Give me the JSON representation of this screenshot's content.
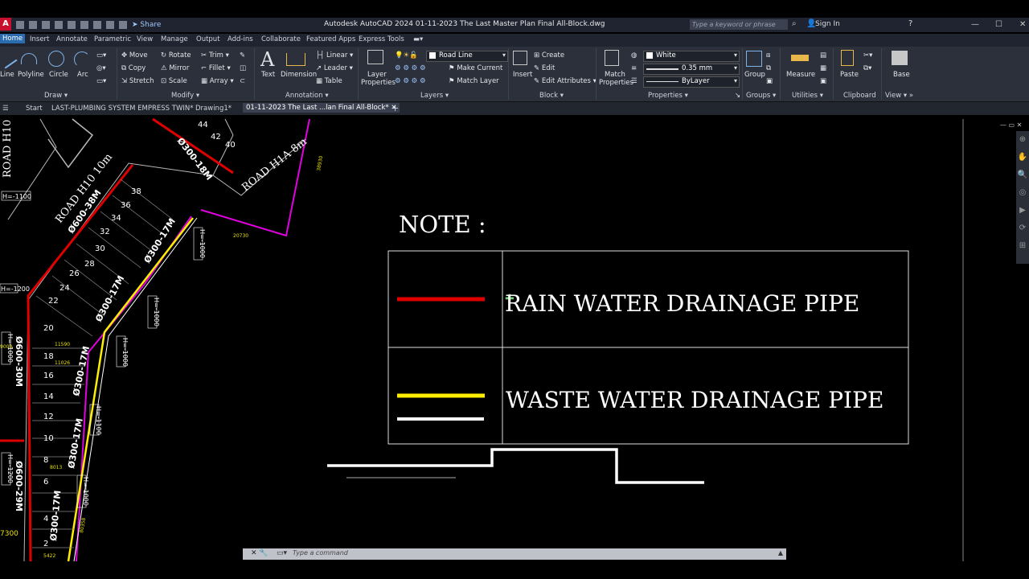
{
  "app": {
    "logo": "A",
    "title": "Autodesk AutoCAD 2024    01-11-2023 The Last Master Plan Final All-Block.dwg",
    "share": "Share",
    "search_placeholder": "Type a keyword or phrase",
    "sign_in": "Sign In"
  },
  "menu_tabs": [
    "Home",
    "Insert",
    "Annotate",
    "Parametric",
    "View",
    "Manage",
    "Output",
    "Add-ins",
    "Collaborate",
    "Featured Apps",
    "Express Tools"
  ],
  "ribbon": {
    "draw": {
      "line": "Line",
      "polyline": "Polyline",
      "circle": "Circle",
      "arc": "Arc",
      "panel": "Draw"
    },
    "modify": {
      "move": "Move",
      "rotate": "Rotate",
      "trim": "Trim",
      "copy": "Copy",
      "mirror": "Mirror",
      "fillet": "Fillet",
      "stretch": "Stretch",
      "scale": "Scale",
      "array": "Array",
      "panel": "Modify"
    },
    "annotation": {
      "text": "Text",
      "dimension": "Dimension",
      "linear": "Linear",
      "leader": "Leader",
      "table": "Table",
      "panel": "Annotation"
    },
    "layers": {
      "layer_properties_1": "Layer",
      "layer_properties_2": "Properties",
      "current_layer": "Road Line",
      "make_current": "Make Current",
      "match_layer": "Match Layer",
      "panel": "Layers"
    },
    "block": {
      "insert": "Insert",
      "create": "Create",
      "edit": "Edit",
      "edit_attributes": "Edit Attributes",
      "panel": "Block"
    },
    "properties": {
      "match_1": "Match",
      "match_2": "Properties",
      "color": "White",
      "lineweight": "0.35 mm",
      "linetype": "ByLayer",
      "panel": "Properties"
    },
    "groups": {
      "group": "Group",
      "panel": "Groups"
    },
    "utilities": {
      "measure": "Measure",
      "panel": "Utilities"
    },
    "clipboard": {
      "paste": "Paste",
      "panel": "Clipboard"
    },
    "view": {
      "base": "Base",
      "panel": "View"
    }
  },
  "file_tabs": [
    "Start",
    "LAST-PLUMBING SYSTEM EMPRESS TWIN*",
    "Drawing1*",
    "01-11-2023 The Last ...lan Final All-Block*"
  ],
  "drawing": {
    "note_title": "NOTE :",
    "legend": [
      {
        "label": "RAIN WATER DRAINAGE PIPE",
        "color": "#e00000"
      },
      {
        "label": "WASTE WATER DRAINAGE PIPE",
        "color": "#ffee00"
      }
    ],
    "roads": [
      "ROAD H10 10m",
      "ROAD H1A 8m",
      "ROAD H10"
    ],
    "pipe_labels": [
      "Ø300-18M",
      "Ø600-38M",
      "Ø300-17M",
      "Ø300-17M",
      "Ø300-17M",
      "Ø300-17M",
      "Ø600-30M",
      "Ø600-29M",
      "Ø300-17M"
    ],
    "lot_numbers": [
      "44",
      "42",
      "40",
      "38",
      "36",
      "34",
      "32",
      "30",
      "28",
      "26",
      "24",
      "22",
      "20",
      "18",
      "16",
      "14",
      "12",
      "10",
      "8",
      "6",
      "4",
      "2"
    ],
    "h_tags": [
      "H=-1100",
      "H=-1200",
      "H=-1000",
      "H=-1000",
      "H=-1000",
      "H=-1100",
      "H=-1000",
      "H=-1200",
      "H=-1000"
    ],
    "small_dims": [
      "20730",
      "11590",
      "11026",
      "8013",
      "5422",
      "9000",
      "80358",
      "38930",
      "7300"
    ]
  },
  "command_line": {
    "placeholder": "Type a command"
  }
}
